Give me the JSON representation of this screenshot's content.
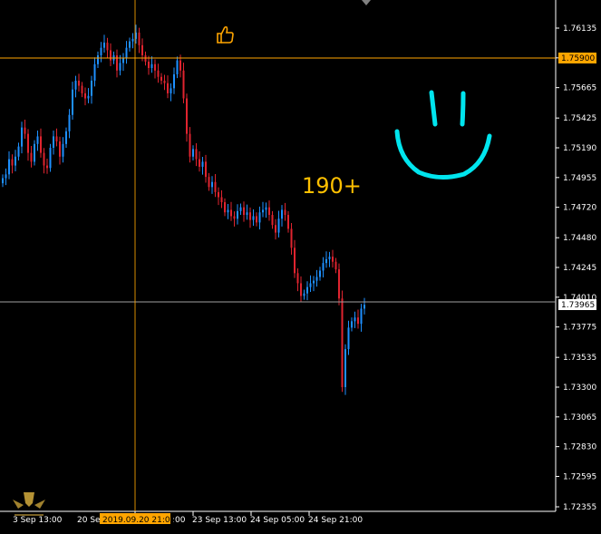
{
  "colors": {
    "background": "#000000",
    "axis": "#ffffff",
    "bull": "#1e90ff",
    "bear": "#e0242f",
    "hline_orange": "#ffa500",
    "hline_grey": "#a0a0a0",
    "crosshair": "#ffa500",
    "smile": "#00e5ee",
    "annotation": "#ffc000"
  },
  "chart_data": {
    "type": "candlestick",
    "ylim": [
      1.7223,
      1.7625
    ],
    "y_ticks": [
      "1.76135",
      "1.75900",
      "1.75665",
      "1.75425",
      "1.75190",
      "1.74955",
      "1.74720",
      "1.74480",
      "1.74245",
      "1.74010",
      "1.73775",
      "1.73535",
      "1.73300",
      "1.73065",
      "1.72830",
      "1.72595",
      "1.72355"
    ],
    "x_ticks": [
      "20 Sep 13:00",
      "20 Sep 21:00",
      "23 Sep 13:00",
      "24 Sep 05:00",
      "24 Sep 21:00"
    ],
    "x_tick_display": [
      "3 Sep 13:00",
      "20 Se",
      ":00",
      "23 Sep 13:00",
      "24 Sep 05:00",
      "24 Sep 21:00"
    ],
    "crosshair_time": "2019.09.20 21:00",
    "price_line_orange": "1.75900",
    "price_line_current": "1.73965",
    "price_markers": [
      1.759,
      1.73965
    ],
    "close_series": [
      1.7495,
      1.7498,
      1.751,
      1.7505,
      1.7512,
      1.752,
      1.7535,
      1.753,
      1.7515,
      1.7508,
      1.7522,
      1.7528,
      1.7515,
      1.7505,
      1.7503,
      1.7519,
      1.7528,
      1.7524,
      1.7512,
      1.7522,
      1.7532,
      1.7545,
      1.7565,
      1.7572,
      1.7568,
      1.7562,
      1.7558,
      1.756,
      1.7572,
      1.7585,
      1.7592,
      1.7598,
      1.7602,
      1.7596,
      1.7588,
      1.7592,
      1.758,
      1.7586,
      1.759,
      1.7598,
      1.7603,
      1.7605,
      1.761,
      1.76,
      1.7592,
      1.7587,
      1.7582,
      1.7585,
      1.758,
      1.7575,
      1.7572,
      1.757,
      1.7562,
      1.7566,
      1.7577,
      1.7588,
      1.758,
      1.7558,
      1.753,
      1.7512,
      1.7518,
      1.751,
      1.7504,
      1.7508,
      1.7496,
      1.7488,
      1.7492,
      1.7484,
      1.748,
      1.7476,
      1.7468,
      1.747,
      1.7465,
      1.7463,
      1.7469,
      1.7472,
      1.7466,
      1.7468,
      1.7462,
      1.7465,
      1.746,
      1.7468,
      1.747,
      1.7472,
      1.7466,
      1.7458,
      1.7452,
      1.7463,
      1.747,
      1.7466,
      1.7455,
      1.744,
      1.742,
      1.7412,
      1.7402,
      1.7404,
      1.7409,
      1.7412,
      1.7414,
      1.7417,
      1.7422,
      1.7428,
      1.7431,
      1.7433,
      1.7429,
      1.7423,
      1.74,
      1.733,
      1.736,
      1.7377,
      1.7382,
      1.7385,
      1.738,
      1.7392,
      1.7395
    ]
  },
  "annotations": {
    "score_text": "190+",
    "thumbs_up_icon": "thumbs-up-icon"
  },
  "watermark_icon": "logo-icon"
}
